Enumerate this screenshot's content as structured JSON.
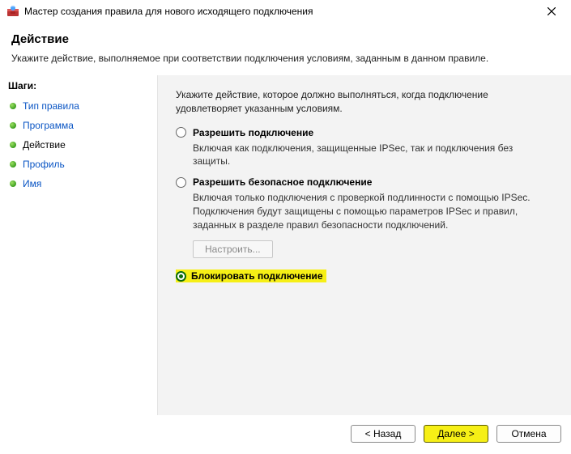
{
  "window": {
    "title": "Мастер создания правила для нового исходящего подключения"
  },
  "header": {
    "title": "Действие",
    "subtitle": "Укажите действие, выполняемое при соответствии подключения условиям, заданным в данном правиле."
  },
  "sidebar": {
    "title": "Шаги:",
    "items": [
      {
        "label": "Тип правила"
      },
      {
        "label": "Программа"
      },
      {
        "label": "Действие"
      },
      {
        "label": "Профиль"
      },
      {
        "label": "Имя"
      }
    ]
  },
  "content": {
    "intro": "Укажите действие, которое должно выполняться, когда подключение удовлетворяет указанным условиям.",
    "options": [
      {
        "label": "Разрешить подключение",
        "desc": "Включая как подключения, защищенные IPSec, так и подключения без защиты."
      },
      {
        "label": "Разрешить безопасное подключение",
        "desc": "Включая только подключения с проверкой подлинности с помощью IPSec. Подключения будут защищены с помощью параметров IPSec и правил, заданных в разделе правил безопасности подключений."
      },
      {
        "label": "Блокировать подключение"
      }
    ],
    "configure_label": "Настроить..."
  },
  "buttons": {
    "back": "< Назад",
    "next": "Далее >",
    "cancel": "Отмена"
  }
}
